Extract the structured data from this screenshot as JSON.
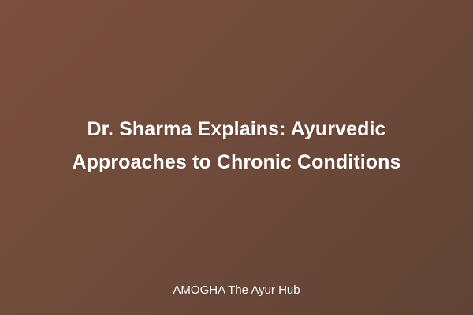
{
  "card": {
    "title_line_1": "Dr. Sharma Explains: Ayurvedic",
    "title_line_2": "Approaches to Chronic Conditions",
    "footer": "AMOGHA The Ayur Hub"
  },
  "colors": {
    "background_start": "#7a4f3e",
    "background_end": "#5f4334",
    "text": "#ffffff"
  }
}
